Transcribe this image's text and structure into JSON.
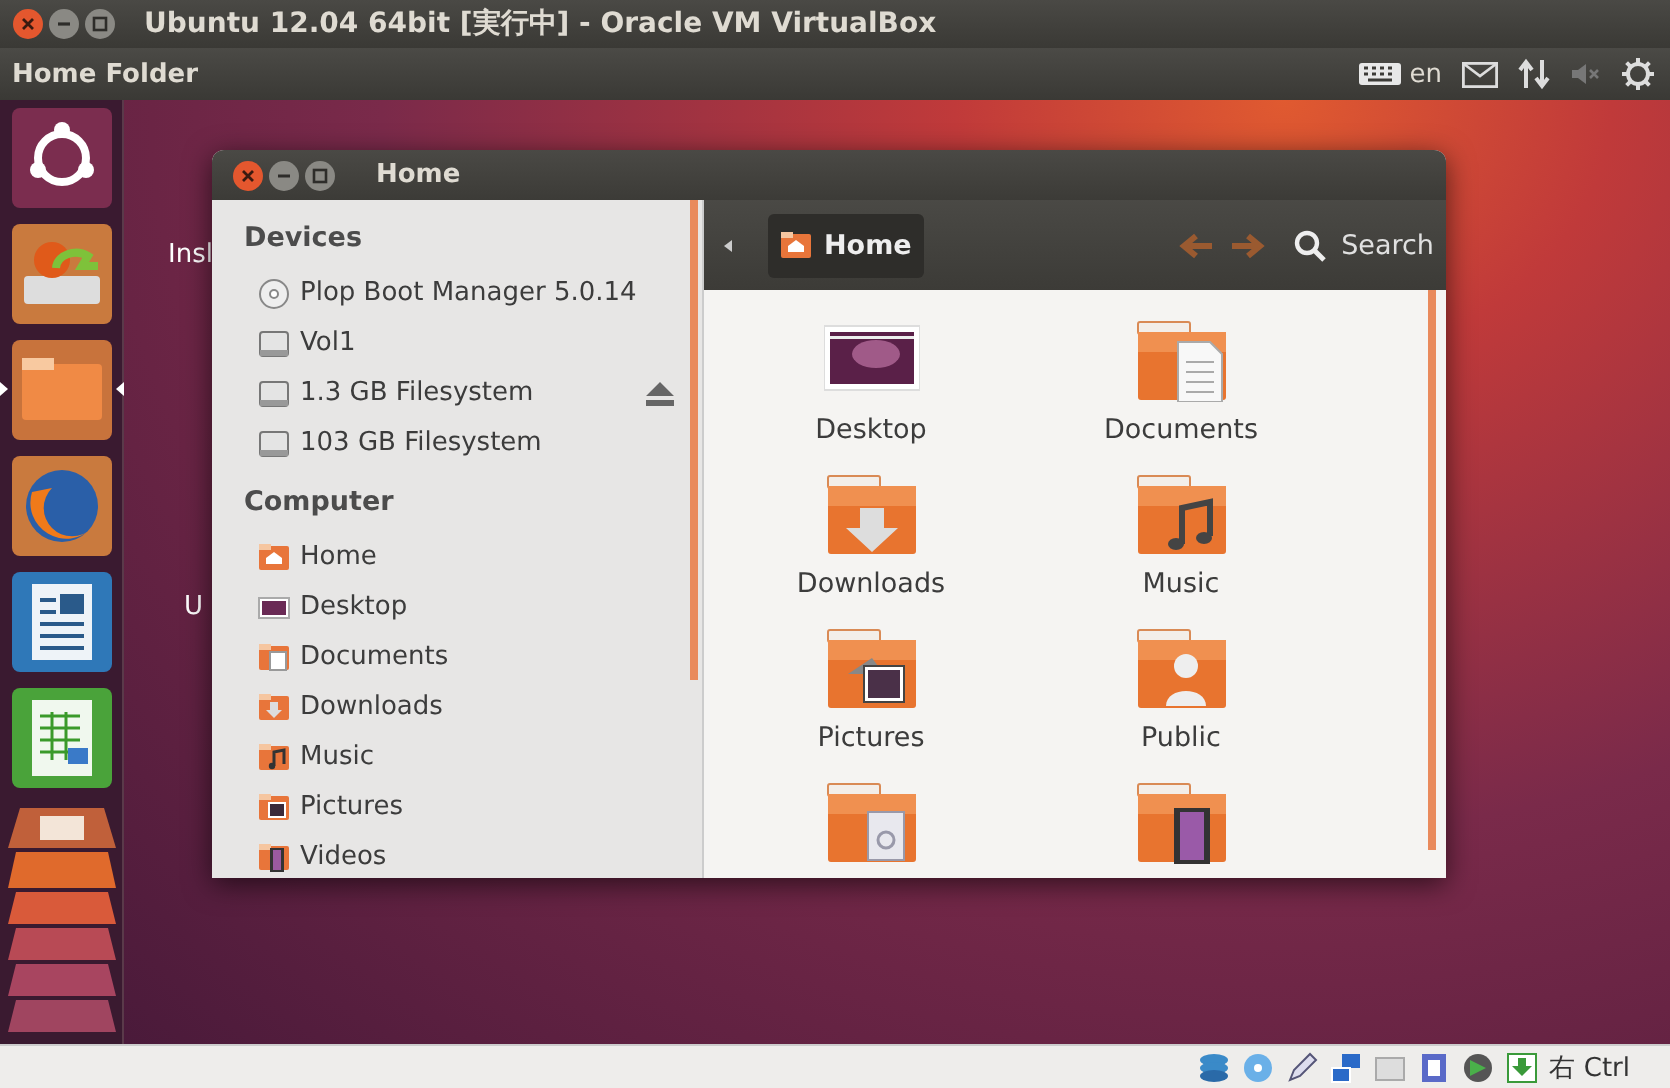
{
  "vbox_window": {
    "title": "Ubuntu 12.04 64bit [実行中] - Oracle VM VirtualBox"
  },
  "top_panel": {
    "app_title": "Home Folder",
    "keyboard_label": "en"
  },
  "launcher": [
    {
      "kind": "dash",
      "active": false
    },
    {
      "kind": "installer",
      "active": false
    },
    {
      "kind": "files",
      "active": true
    },
    {
      "kind": "browser",
      "active": false
    },
    {
      "kind": "writer",
      "active": false
    },
    {
      "kind": "calc",
      "active": false
    },
    {
      "kind": "stack",
      "active": false
    }
  ],
  "desktop_labels": [
    "Insl",
    "U"
  ],
  "file_window": {
    "title": "Home",
    "sidebar": [
      {
        "heading": "Devices",
        "items": [
          {
            "label": "Plop Boot Manager 5.0.14",
            "kind": "disc",
            "ejectable": false
          },
          {
            "label": "Vol1",
            "kind": "drive",
            "ejectable": false
          },
          {
            "label": "1.3 GB Filesystem",
            "kind": "drive",
            "ejectable": true
          },
          {
            "label": "103 GB Filesystem",
            "kind": "drive",
            "ejectable": false
          }
        ]
      },
      {
        "heading": "Computer",
        "items": [
          {
            "label": "Home",
            "kind": "home"
          },
          {
            "label": "Desktop",
            "kind": "desktop"
          },
          {
            "label": "Documents",
            "kind": "documents"
          },
          {
            "label": "Downloads",
            "kind": "downloads"
          },
          {
            "label": "Music",
            "kind": "music"
          },
          {
            "label": "Pictures",
            "kind": "pictures"
          },
          {
            "label": "Videos",
            "kind": "videos"
          }
        ]
      }
    ],
    "path_button": "Home",
    "search": "Search",
    "files": [
      {
        "label": "Desktop",
        "kind": "desktop"
      },
      {
        "label": "Documents",
        "kind": "documents"
      },
      {
        "label": "Downloads",
        "kind": "downloads"
      },
      {
        "label": "Music",
        "kind": "music"
      },
      {
        "label": "Pictures",
        "kind": "pictures"
      },
      {
        "label": "Public",
        "kind": "public"
      },
      {
        "kind": "templates"
      },
      {
        "kind": "videos"
      }
    ]
  },
  "status_bar": {
    "host_key": "右 Ctrl"
  }
}
